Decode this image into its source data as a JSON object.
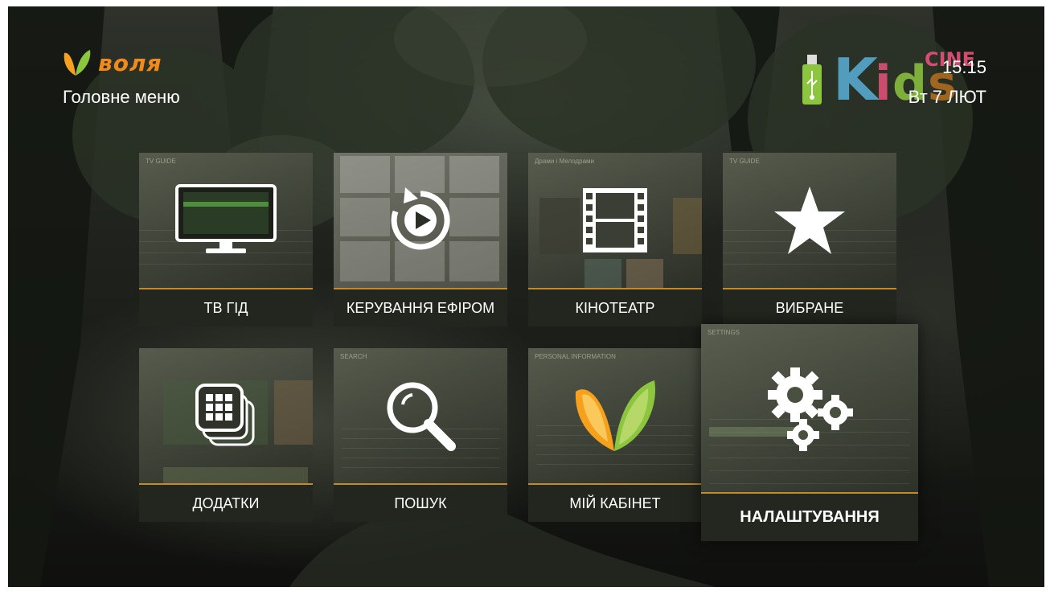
{
  "brand": {
    "name": "воля",
    "accent": "#f08a1c"
  },
  "header": {
    "title": "Головне меню",
    "time": "15:15",
    "date": "Вт 7 ЛЮТ"
  },
  "channel_logo": {
    "name": "Kids CINE"
  },
  "status_icons": {
    "usb": "usb-icon"
  },
  "tiles": [
    {
      "label": "ТВ ГІД",
      "icon": "tv-monitor-icon",
      "preview": "TV GUIDE"
    },
    {
      "label": "КЕРУВАННЯ ЕФІРОМ",
      "icon": "replay-icon",
      "preview": ""
    },
    {
      "label": "КІНОТЕАТР",
      "icon": "film-strip-icon",
      "preview": "Драми і Мелодрами"
    },
    {
      "label": "ВИБРАНЕ",
      "icon": "star-icon",
      "preview": "TV GUIDE"
    },
    {
      "label": "ДОДАТКИ",
      "icon": "apps-icon",
      "preview": ""
    },
    {
      "label": "ПОШУК",
      "icon": "search-icon",
      "preview": "SEARCH"
    },
    {
      "label": "МІЙ КАБІНЕТ",
      "icon": "volia-logo-icon",
      "preview": "PERSONAL INFORMATION"
    },
    {
      "label": "НАЛАШТУВАННЯ",
      "icon": "gears-icon",
      "preview": "SETTINGS",
      "focused": true
    }
  ],
  "colors": {
    "tile_separator": "#c28a2a",
    "label_bg": "#20241c"
  }
}
